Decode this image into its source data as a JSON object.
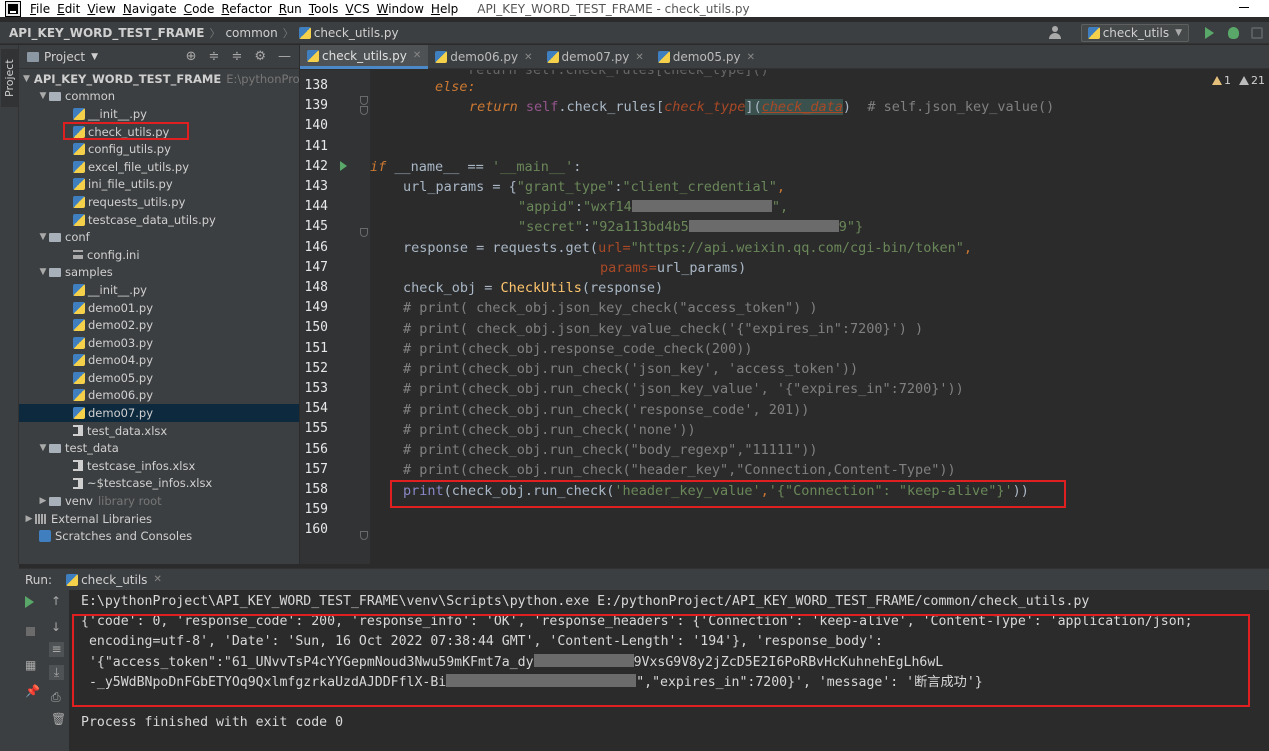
{
  "menubar": {
    "items": [
      {
        "label": "File",
        "u": "F",
        "rest": "ile"
      },
      {
        "label": "Edit",
        "u": "E",
        "rest": "dit"
      },
      {
        "label": "View",
        "u": "V",
        "rest": "iew"
      },
      {
        "label": "Navigate",
        "u": "N",
        "rest": "avigate"
      },
      {
        "label": "Code",
        "u": "C",
        "rest": "ode"
      },
      {
        "label": "Refactor",
        "u": "R",
        "rest": "efactor"
      },
      {
        "label": "Run",
        "u": "R",
        "rest": "un"
      },
      {
        "label": "Tools",
        "u": "T",
        "rest": "ools"
      },
      {
        "label": "VCS",
        "u": "V",
        "rest": "CS"
      },
      {
        "label": "Window",
        "u": "W",
        "rest": "indow"
      },
      {
        "label": "Help",
        "u": "H",
        "rest": "elp"
      }
    ],
    "window_title": "API_KEY_WORD_TEST_FRAME - check_utils.py"
  },
  "navbar": {
    "project": "API_KEY_WORD_TEST_FRAME",
    "folder": "common",
    "file": "check_utils.py",
    "run_config": "check_utils"
  },
  "activity": {
    "project_tab": "Project"
  },
  "project_panel": {
    "title": "Project",
    "root": "API_KEY_WORD_TEST_FRAME",
    "root_path": "E:\\pythonProjec",
    "tree": {
      "common": "common",
      "init1": "__init__.py",
      "check_utils": "check_utils.py",
      "config_utils": "config_utils.py",
      "excel_file_utils": "excel_file_utils.py",
      "ini_file_utils": "ini_file_utils.py",
      "requests_utils": "requests_utils.py",
      "testcase_data_utils": "testcase_data_utils.py",
      "conf": "conf",
      "config_ini": "config.ini",
      "samples": "samples",
      "init2": "__init__.py",
      "demo01": "demo01.py",
      "demo02": "demo02.py",
      "demo03": "demo03.py",
      "demo04": "demo04.py",
      "demo05": "demo05.py",
      "demo06": "demo06.py",
      "demo07": "demo07.py",
      "test_data_xlsx": "test_data.xlsx",
      "test_data": "test_data",
      "testcase_infos": "testcase_infos.xlsx",
      "testcase_infos_tmp": "~$testcase_infos.xlsx",
      "venv": "venv",
      "venv_note": "library root",
      "ext_libs": "External Libraries",
      "scratches": "Scratches and Consoles"
    }
  },
  "tabs": [
    "check_utils.py",
    "demo06.py",
    "demo07.py",
    "demo05.py"
  ],
  "warnings": {
    "yellow": "1",
    "grey": "21"
  },
  "code": {
    "line_numbers": [
      "138",
      "139",
      "140",
      "141",
      "142",
      "143",
      "144",
      "145",
      "146",
      "147",
      "148",
      "149",
      "150",
      "151",
      "152",
      "153",
      "154",
      "155",
      "156",
      "157",
      "158",
      "159",
      "160"
    ],
    "l138": "else:",
    "l139_a": "return ",
    "l139_b": "self",
    "l139_c": ".check_rules[",
    "l139_d": "check_type",
    "l139_e": "](",
    "l139_f": "check_data",
    "l139_g": ")  ",
    "l139_h": "# self.json_key_value()",
    "l142_a": "if ",
    "l142_b": "__name__ == ",
    "l142_c": "'__main__'",
    "l142_d": ":",
    "l143_a": "url_params = {",
    "l143_b": "\"grant_type\"",
    "l143_c": ":",
    "l143_d": "\"client_credential\"",
    "l143_e": ",",
    "l144_a": "\"appid\"",
    "l144_b": ":",
    "l144_c": "\"wxf14",
    "l144_d": "\",",
    "l145_a": "\"secret\"",
    "l145_b": ":",
    "l145_c": "\"92a113bd4b5",
    "l145_d": "9\"}",
    "l146_a": "response = requests.get(",
    "l146_b": "url=",
    "l146_c": "\"https://api.weixin.qq.com/cgi-bin/token\"",
    "l146_d": ",",
    "l147_a": "params=",
    "l147_b": "url_params)",
    "l148_a": "check_obj = ",
    "l148_b": "CheckUtils",
    "l148_c": "(response)",
    "l149": "# print( check_obj.json_key_check(\"access_token\") )",
    "l150": "# print( check_obj.json_key_value_check('{\"expires_in\":7200}') )",
    "l151": "# print(check_obj.response_code_check(200))",
    "l152": "# print(check_obj.run_check('json_key', 'access_token'))",
    "l153": "# print(check_obj.run_check('json_key_value', '{\"expires_in\":7200}'))",
    "l154": "# print(check_obj.run_check('response_code', 201))",
    "l155": "# print(check_obj.run_check('none'))",
    "l156": "# print(check_obj.run_check(\"body_regexp\",\"11111\"))",
    "l157": "# print(check_obj.run_check(\"header_key\",\"Connection,Content-Type\"))",
    "l158_a": "print",
    "l158_b": "(check_obj.run_check(",
    "l158_c": "'header_key_value'",
    "l158_d": ",",
    "l158_e": "'{\"Connection\": \"keep-alive\"}'",
    "l158_f": "))"
  },
  "run": {
    "label": "Run:",
    "tab": "check_utils",
    "cmd": "E:\\pythonProject\\API_KEY_WORD_TEST_FRAME\\venv\\Scripts\\python.exe E:/pythonProject/API_KEY_WORD_TEST_FRAME/common/check_utils.py",
    "out1": "{'code': 0, 'response_code': 200, 'response_info': 'OK', 'response_headers': {'Connection': 'keep-alive', 'Content-Type': 'application/json;",
    "out2": " encoding=utf-8', 'Date': 'Sun, 16 Oct 2022 07:38:44 GMT', 'Content-Length': '194'}, 'response_body':",
    "out3_a": " '{\"access_token\":\"61_UNvvTsP4cYYGepmNoud3Nwu59mKFmt7a_dy",
    "out3_b": "9VxsG9V8y2jZcD5E2I6PoRBvHcKuhnehEgLh6wL",
    "out4_a": " -_y5WdBNpoDnFGbETYOq9QxlmfgzrkaUzdAJDDFflX-Bi",
    "out4_b": "\",\"expires_in\":7200}', 'message': '断言成功'}",
    "exit": "Process finished with exit code 0"
  }
}
